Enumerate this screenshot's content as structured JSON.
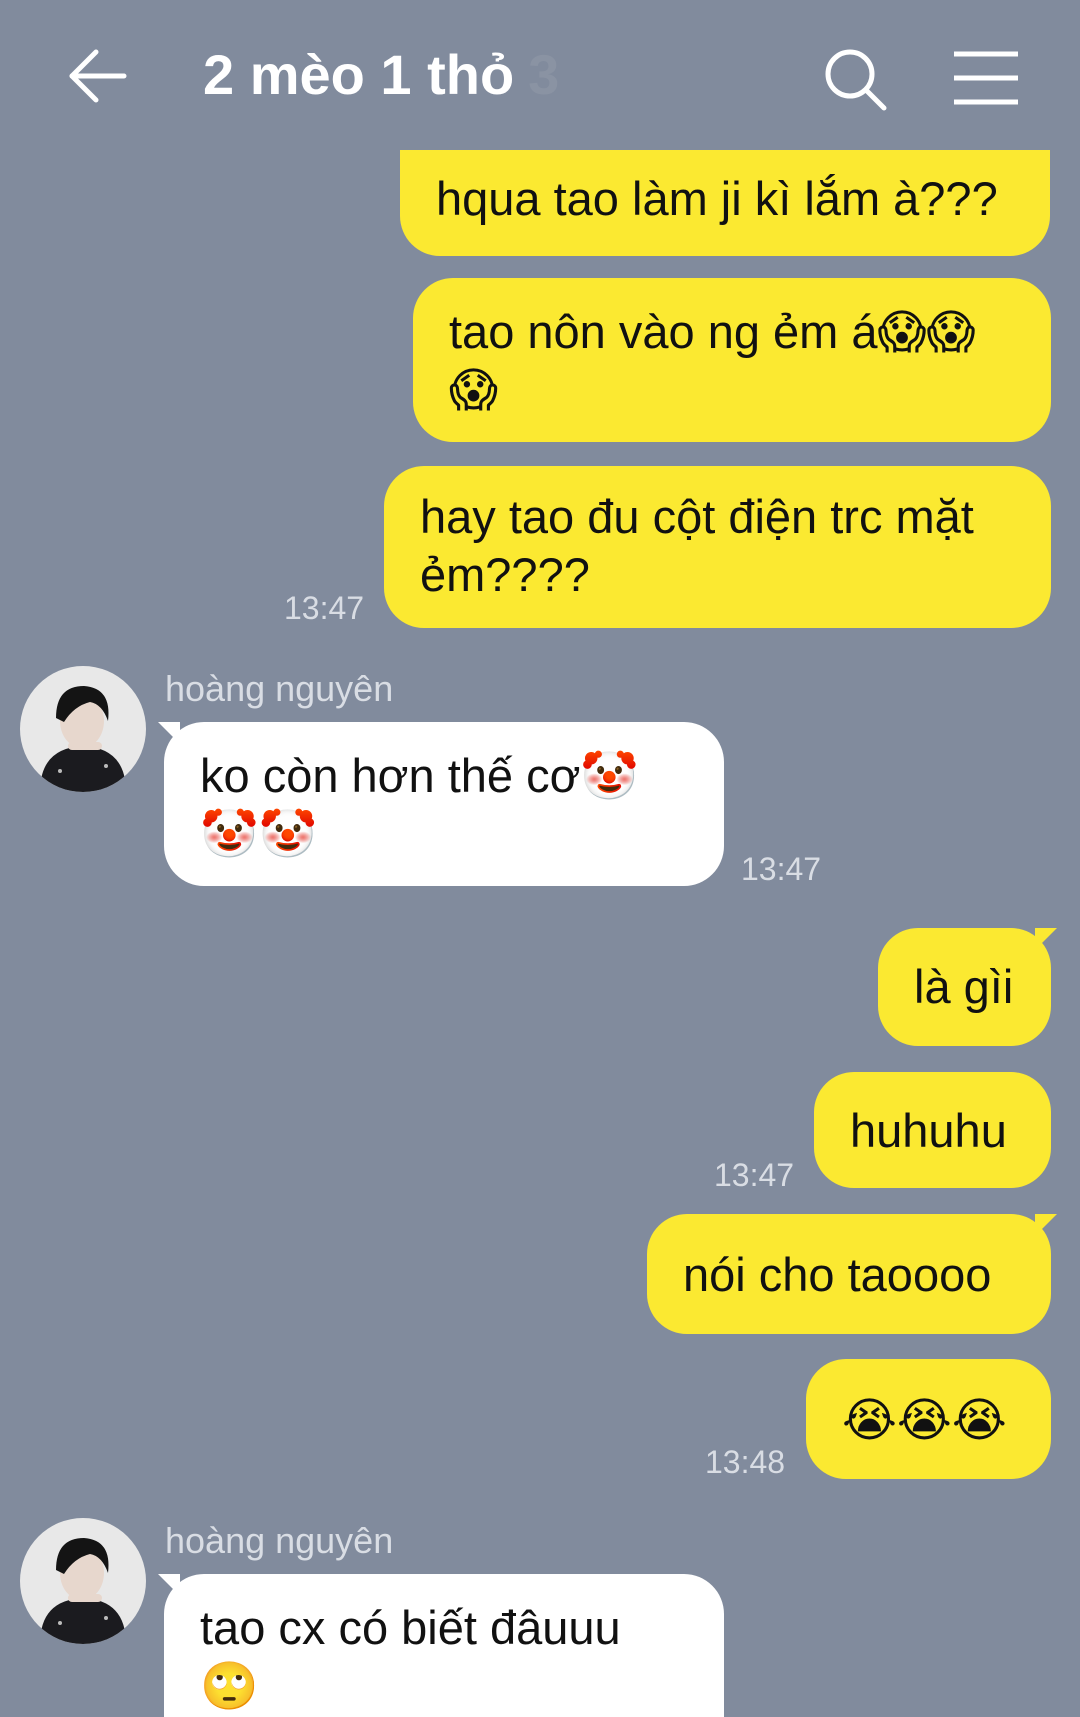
{
  "header": {
    "title": "2 mèo 1 thỏ",
    "member_count": "3",
    "back_icon": "arrow-left-icon",
    "search_icon": "search-icon",
    "menu_icon": "hamburger-menu-icon"
  },
  "colors": {
    "background": "#818b9d",
    "outgoing_bubble": "#fbe931",
    "incoming_bubble": "#ffffff"
  },
  "messages": [
    {
      "text": "hqua tao làm ji kì lắm à???"
    },
    {
      "text": "tao nôn vào ng ẻm á😱😱",
      "text2": "😱"
    },
    {
      "text": "hay tao đu cột điện trc mặt",
      "text2": "ẻm????",
      "time": "13:47"
    },
    {
      "sender": "hoàng nguyên",
      "text": "ko còn hơn thế cơ🤡",
      "text2": "🤡🤡",
      "time": "13:47"
    },
    {
      "text": "là gìi"
    },
    {
      "text": "huhuhu",
      "time": "13:47"
    },
    {
      "text": "nói cho taoooo"
    },
    {
      "text": "😭😭😭",
      "time": "13:48"
    },
    {
      "sender": "hoàng nguyên",
      "text": "tao cx có biết đâuuu",
      "text2": "🙄"
    }
  ]
}
